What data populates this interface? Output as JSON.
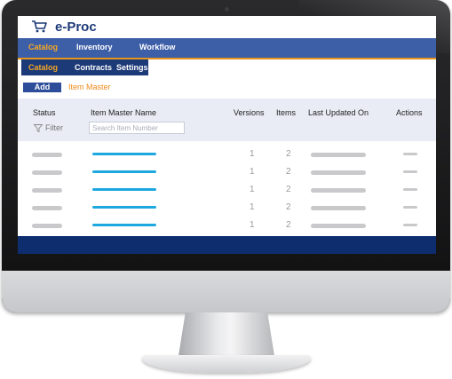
{
  "app": {
    "title": "e-Proc"
  },
  "main_nav": [
    {
      "label": "Catalog",
      "active": true
    },
    {
      "label": "Inventory",
      "active": false
    },
    {
      "label": "Workflow",
      "active": false
    }
  ],
  "sub_nav": [
    {
      "label": "Catalog",
      "active": true
    },
    {
      "label": "Contracts",
      "active": false
    },
    {
      "label": "Settings",
      "active": false
    }
  ],
  "toolbar": {
    "add_label": "Add",
    "breadcrumb": "Item Master"
  },
  "table": {
    "columns": [
      "Status",
      "Item Master Name",
      "Versions",
      "Items",
      "Last Updated On",
      "Actions"
    ],
    "filter_label": "Filter",
    "search_placeholder": "Search Item Number",
    "rows": [
      {
        "versions": "1",
        "items": "2"
      },
      {
        "versions": "1",
        "items": "2"
      },
      {
        "versions": "1",
        "items": "2"
      },
      {
        "versions": "1",
        "items": "2"
      },
      {
        "versions": "1",
        "items": "2"
      }
    ]
  },
  "colors": {
    "nav_blue": "#3d5fa8",
    "dark_blue": "#1d3a78",
    "accent_orange": "#f5a623",
    "link_blue": "#1ea8e0",
    "footer_navy": "#0e2d6e"
  }
}
